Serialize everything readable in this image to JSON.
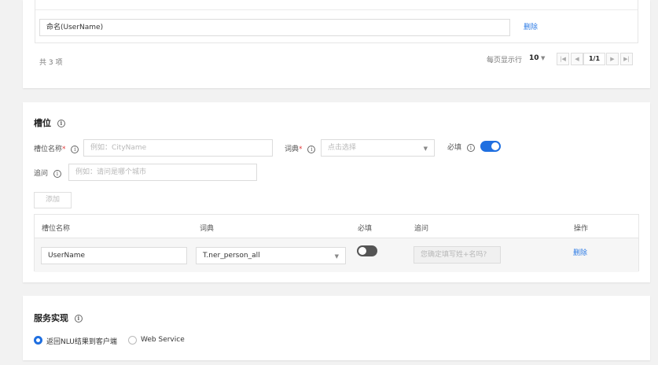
{
  "top_table": {
    "row_value": "命名(UserName)",
    "delete_label": "删除",
    "total_label": "共 3 项",
    "page_size_label": "每页显示行",
    "page_size_value": "10",
    "page_first": "|◀",
    "page_prev": "◀",
    "page_current": "1/1",
    "page_next": "▶",
    "page_last": "▶|"
  },
  "slot": {
    "title": "槽位",
    "name_label": "槽位名称",
    "name_placeholder": "例如：CityName",
    "dict_label": "词典",
    "dict_placeholder": "点击选择",
    "required_label": "必填",
    "required_enabled": true,
    "ask_label": "追问",
    "ask_placeholder": "例如：请问是哪个城市",
    "add_button": "添加",
    "table": {
      "headers": [
        "槽位名称",
        "词典",
        "必填",
        "追问",
        "操作"
      ],
      "rows": [
        {
          "name": "UserName",
          "dict": "T.ner_person_all",
          "required": false,
          "ask_placeholder": "您确定填写姓+名吗?",
          "action": "删除"
        }
      ]
    }
  },
  "service": {
    "title": "服务实现",
    "options": [
      {
        "label": "返回NLU结果到客户端",
        "selected": true
      },
      {
        "label": "Web Service",
        "selected": false
      }
    ]
  },
  "colors": {
    "accent": "#1f6fe0",
    "link": "#2d7be5",
    "toggle_off": "#555555"
  },
  "icons": {
    "info": "info-circle-icon",
    "dropdown": "caret-down-icon"
  }
}
